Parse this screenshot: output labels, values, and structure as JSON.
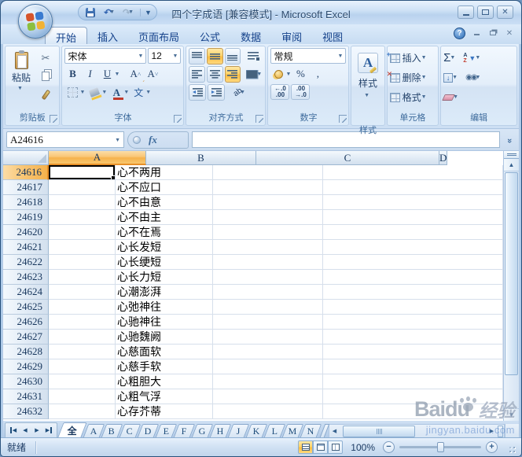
{
  "titlebar": {
    "title": "四个字成语 [兼容模式] - Microsoft Excel"
  },
  "ribbon": {
    "tabs": [
      {
        "label": "开始",
        "active": true
      },
      {
        "label": "插入"
      },
      {
        "label": "页面布局"
      },
      {
        "label": "公式"
      },
      {
        "label": "数据"
      },
      {
        "label": "审阅"
      },
      {
        "label": "视图"
      }
    ],
    "clipboard": {
      "label": "剪贴板",
      "paste": "粘贴"
    },
    "font": {
      "label": "字体",
      "name": "宋体",
      "size": "12",
      "bold": "B",
      "italic": "I",
      "underline": "U",
      "grow": "A",
      "shrink": "A",
      "color_a": "A",
      "phonetic": "文"
    },
    "alignment": {
      "label": "对齐方式",
      "orientation": "ab"
    },
    "number": {
      "label": "数字",
      "format": "常规",
      "percent": "%",
      "comma": ",",
      "inc_top": "←.0",
      "inc_bot": ".00",
      "dec_top": ".00",
      "dec_bot": "→.0"
    },
    "styles": {
      "label": "样式",
      "button": "样式",
      "icon_a": "A"
    },
    "cells": {
      "label": "单元格",
      "insert": "插入",
      "delete": "删除",
      "format": "格式"
    },
    "editing": {
      "label": "编辑",
      "autosum": "Σ",
      "sort_a": "A",
      "sort_z": "Z",
      "fill_arrow": "↓",
      "find": "◉◉"
    }
  },
  "formula_bar": {
    "name_box": "A24616",
    "fx": "fx",
    "formula": ""
  },
  "grid": {
    "selected_cell": "A24616",
    "columns": [
      {
        "label": "A",
        "selected": true
      },
      {
        "label": "B"
      },
      {
        "label": "C"
      },
      {
        "label": "D"
      }
    ],
    "rows": [
      {
        "num": "24616",
        "idiom": "心不两用",
        "selected": true
      },
      {
        "num": "24617",
        "idiom": "心不应口"
      },
      {
        "num": "24618",
        "idiom": "心不由意"
      },
      {
        "num": "24619",
        "idiom": "心不由主"
      },
      {
        "num": "24620",
        "idiom": "心不在焉"
      },
      {
        "num": "24621",
        "idiom": "心长发短"
      },
      {
        "num": "24622",
        "idiom": "心长绠短"
      },
      {
        "num": "24623",
        "idiom": "心长力短"
      },
      {
        "num": "24624",
        "idiom": "心潮澎湃"
      },
      {
        "num": "24625",
        "idiom": "心弛神往"
      },
      {
        "num": "24626",
        "idiom": "心驰神往"
      },
      {
        "num": "24627",
        "idiom": "心驰魏阙"
      },
      {
        "num": "24628",
        "idiom": "心慈面软"
      },
      {
        "num": "24629",
        "idiom": "心慈手软"
      },
      {
        "num": "24630",
        "idiom": "心粗胆大"
      },
      {
        "num": "24631",
        "idiom": "心粗气浮"
      },
      {
        "num": "24632",
        "idiom": "心存芥蒂"
      }
    ]
  },
  "sheet_tabs": [
    {
      "label": "全",
      "active": true
    },
    {
      "label": "A"
    },
    {
      "label": "B"
    },
    {
      "label": "C"
    },
    {
      "label": "D"
    },
    {
      "label": "E"
    },
    {
      "label": "F"
    },
    {
      "label": "G"
    },
    {
      "label": "H"
    },
    {
      "label": "J"
    },
    {
      "label": "K"
    },
    {
      "label": "L"
    },
    {
      "label": "M"
    },
    {
      "label": "N"
    }
  ],
  "status_bar": {
    "ready": "就绪",
    "zoom": "100%"
  },
  "watermark": {
    "brand": "Baidu",
    "suffix": "经验",
    "url": "jingyan.baidu.com"
  },
  "colors": {
    "selection_orange": "#f5b24c",
    "chrome_blue": "#bcd4ee",
    "tab_text": "#15428b",
    "grid_line": "#d6dfeb"
  }
}
